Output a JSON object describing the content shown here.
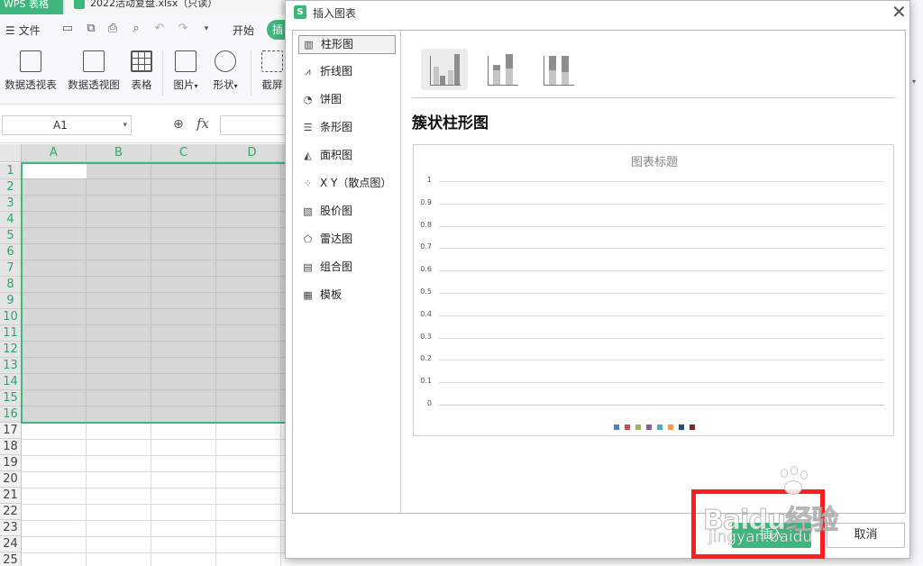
{
  "app": {
    "app_tab": "WPS 表格",
    "file_tab": "2022活动复盘.xlsx（只读）",
    "menu": {
      "file": "文件",
      "start": "开始",
      "insert": "插"
    }
  },
  "ribbon": {
    "buttons": [
      {
        "label": "数据透视表",
        "icon": "pivot-table-icon"
      },
      {
        "label": "数据透视图",
        "icon": "pivot-chart-icon"
      },
      {
        "label": "表格",
        "icon": "table-icon"
      },
      {
        "label": "图片",
        "icon": "picture-icon"
      },
      {
        "label": "形状",
        "icon": "shape-icon"
      },
      {
        "label": "截屏",
        "icon": "screenshot-icon"
      }
    ]
  },
  "formula_bar": {
    "name_box": "A1",
    "fx": "fx"
  },
  "grid": {
    "columns": [
      "A",
      "B",
      "C",
      "D"
    ],
    "rows": [
      "1",
      "2",
      "3",
      "4",
      "5",
      "6",
      "7",
      "8",
      "9",
      "10",
      "11",
      "12",
      "13",
      "14",
      "15",
      "16",
      "17",
      "18",
      "19",
      "20",
      "21",
      "22",
      "23",
      "24",
      "25"
    ],
    "selected_rows": 16,
    "active_cell": "A1"
  },
  "dialog": {
    "title": "插入图表",
    "categories": [
      {
        "label": "柱形图",
        "icon": "column-chart-icon",
        "selected": true
      },
      {
        "label": "折线图",
        "icon": "line-chart-icon"
      },
      {
        "label": "饼图",
        "icon": "pie-chart-icon"
      },
      {
        "label": "条形图",
        "icon": "bar-chart-icon"
      },
      {
        "label": "面积图",
        "icon": "area-chart-icon"
      },
      {
        "label": "X Y（散点图）",
        "icon": "scatter-chart-icon"
      },
      {
        "label": "股价图",
        "icon": "stock-chart-icon"
      },
      {
        "label": "雷达图",
        "icon": "radar-chart-icon"
      },
      {
        "label": "组合图",
        "icon": "combo-chart-icon"
      },
      {
        "label": "模板",
        "icon": "template-icon"
      }
    ],
    "subtypes": [
      "clustered-column-icon",
      "stacked-column-icon",
      "percent-stacked-column-icon"
    ],
    "selected_type_title": "簇状柱形图",
    "insert_button": "插入",
    "cancel_button": "取消"
  },
  "chart_data": {
    "type": "bar",
    "title": "图表标题",
    "categories": [],
    "series": [],
    "ylim": [
      0,
      1
    ],
    "y_ticks": [
      "1",
      "0.9",
      "0.8",
      "0.7",
      "0.6",
      "0.5",
      "0.4",
      "0.3",
      "0.2",
      "0.1",
      "0"
    ],
    "grid": true,
    "legend_position": "bottom",
    "legend_colors": [
      "#4f81bd",
      "#c0504d",
      "#9bbb59",
      "#8064a2",
      "#4bacc6",
      "#f79646",
      "#2c4d75",
      "#772c2a"
    ]
  },
  "watermark": {
    "text": "Baidu经验",
    "sub": "jingyan.baidu"
  },
  "colors": {
    "accent": "#3db77d",
    "highlight": "#ff1e1e"
  }
}
